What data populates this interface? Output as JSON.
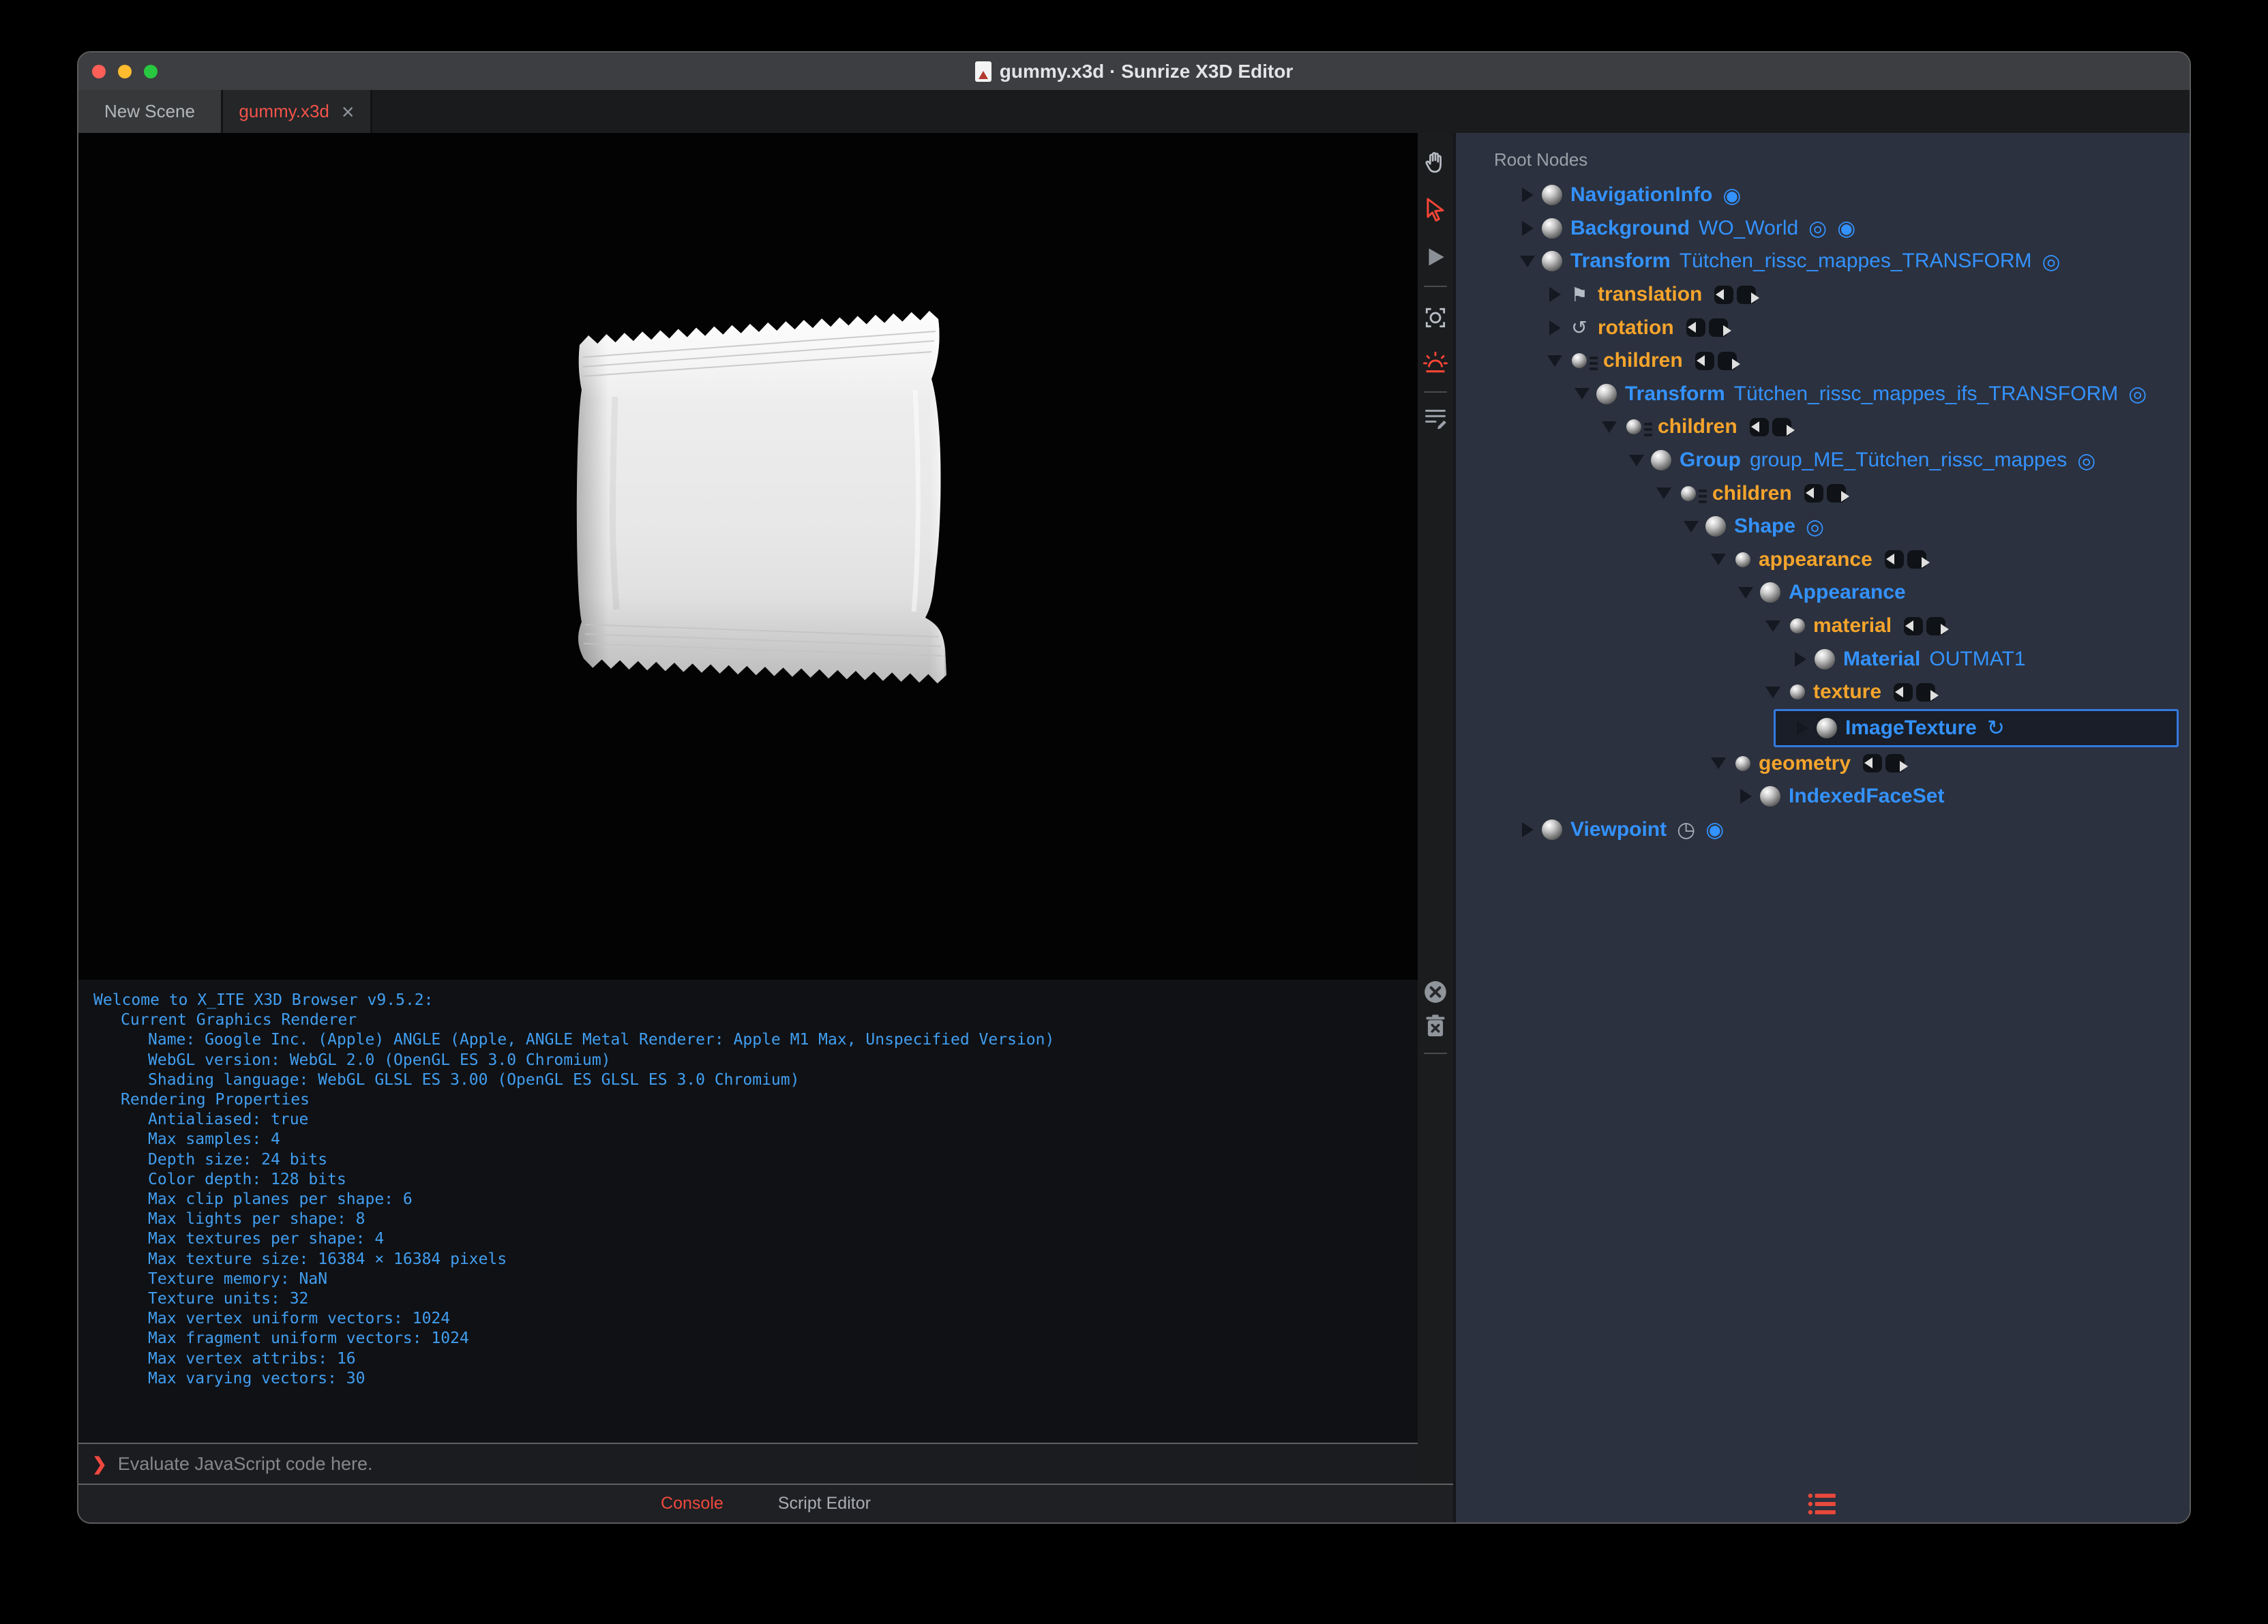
{
  "window": {
    "title": "gummy.x3d · Sunrize X3D Editor"
  },
  "tabs": [
    {
      "label": "New Scene",
      "active": false
    },
    {
      "label": "gummy.x3d",
      "active": true,
      "close": "×"
    }
  ],
  "toolbar": {
    "top_icons": [
      "pan-hand",
      "select-arrow",
      "play",
      "snapshot",
      "headlight",
      "script-editor"
    ],
    "console_icons": [
      "clear-console",
      "clear-console-on-reload"
    ],
    "active_icon_color": "#ff4636"
  },
  "console": {
    "lines": [
      {
        "indent": 0,
        "text": "Welcome to X_ITE X3D Browser v9.5.2:"
      },
      {
        "indent": 1,
        "text": "Current Graphics Renderer"
      },
      {
        "indent": 2,
        "text": "Name: Google Inc. (Apple) ANGLE (Apple, ANGLE Metal Renderer: Apple M1 Max, Unspecified Version)"
      },
      {
        "indent": 2,
        "text": "WebGL version: WebGL 2.0 (OpenGL ES 3.0 Chromium)"
      },
      {
        "indent": 2,
        "text": "Shading language: WebGL GLSL ES 3.00 (OpenGL ES GLSL ES 3.0 Chromium)"
      },
      {
        "indent": 1,
        "text": "Rendering Properties"
      },
      {
        "indent": 2,
        "text": "Antialiased: true"
      },
      {
        "indent": 2,
        "text": "Max samples: 4"
      },
      {
        "indent": 2,
        "text": "Depth size: 24 bits"
      },
      {
        "indent": 2,
        "text": "Color depth: 128 bits"
      },
      {
        "indent": 2,
        "text": "Max clip planes per shape: 6"
      },
      {
        "indent": 2,
        "text": "Max lights per shape: 8"
      },
      {
        "indent": 2,
        "text": "Max textures per shape: 4"
      },
      {
        "indent": 2,
        "text": "Max texture size: 16384 × 16384 pixels"
      },
      {
        "indent": 2,
        "text": "Texture memory: NaN"
      },
      {
        "indent": 2,
        "text": "Texture units: 32"
      },
      {
        "indent": 2,
        "text": "Max vertex uniform vectors: 1024"
      },
      {
        "indent": 2,
        "text": "Max fragment uniform vectors: 1024"
      },
      {
        "indent": 2,
        "text": "Max vertex attribs: 16"
      },
      {
        "indent": 2,
        "text": "Max varying vectors: 30"
      }
    ],
    "prompt_symbol": "❯",
    "prompt_placeholder": "Evaluate JavaScript code here.",
    "tabs": [
      {
        "label": "Console",
        "active": true
      },
      {
        "label": "Script Editor",
        "active": false
      }
    ]
  },
  "outline": {
    "header": "Root Nodes",
    "rows": [
      {
        "level": 0,
        "arrow": "collapsed",
        "icon": "node-sphere",
        "name": "NavigationInfo",
        "name_style": "node",
        "extras": [
          "bind"
        ]
      },
      {
        "level": 0,
        "arrow": "collapsed",
        "icon": "node-sphere",
        "name": "Background",
        "def": "WO_World",
        "name_style": "node",
        "extras": [
          "eye",
          "bind"
        ]
      },
      {
        "level": 0,
        "arrow": "expanded",
        "icon": "node-sphere",
        "name": "Transform",
        "def": "Tütchen_rissc_mappes_TRANSFORM",
        "name_style": "node",
        "extras": [
          "eye"
        ]
      },
      {
        "level": 1,
        "arrow": "collapsed",
        "icon": "field-translation",
        "name": "translation",
        "name_style": "field",
        "extras": [
          "routes"
        ]
      },
      {
        "level": 1,
        "arrow": "collapsed",
        "icon": "field-rotation",
        "name": "rotation",
        "name_style": "field",
        "extras": [
          "routes"
        ]
      },
      {
        "level": 1,
        "arrow": "expanded",
        "icon": "field-children",
        "name": "children",
        "name_style": "field",
        "extras": [
          "routes"
        ]
      },
      {
        "level": 2,
        "arrow": "expanded",
        "icon": "node-sphere",
        "name": "Transform",
        "def": "Tütchen_rissc_mappes_ifs_TRANSFORM",
        "name_style": "node",
        "extras": [
          "eye"
        ]
      },
      {
        "level": 3,
        "arrow": "expanded",
        "icon": "field-children",
        "name": "children",
        "name_style": "field",
        "extras": [
          "routes"
        ]
      },
      {
        "level": 4,
        "arrow": "expanded",
        "icon": "node-sphere",
        "name": "Group",
        "def": "group_ME_Tütchen_rissc_mappes",
        "name_style": "node",
        "extras": [
          "eye"
        ]
      },
      {
        "level": 5,
        "arrow": "expanded",
        "icon": "field-children",
        "name": "children",
        "name_style": "field",
        "extras": [
          "routes"
        ]
      },
      {
        "level": 6,
        "arrow": "expanded",
        "icon": "node-sphere",
        "name": "Shape",
        "name_style": "node",
        "extras": [
          "eye"
        ]
      },
      {
        "level": 7,
        "arrow": "expanded",
        "icon": "field-generic",
        "name": "appearance",
        "name_style": "field",
        "extras": [
          "routes"
        ]
      },
      {
        "level": 8,
        "arrow": "expanded",
        "icon": "node-sphere",
        "name": "Appearance",
        "name_style": "node",
        "extras": []
      },
      {
        "level": 9,
        "arrow": "expanded",
        "icon": "field-generic",
        "name": "material",
        "name_style": "field",
        "extras": [
          "routes"
        ]
      },
      {
        "level": 10,
        "arrow": "collapsed",
        "icon": "node-sphere",
        "name": "Material",
        "def": "OUTMAT1",
        "name_style": "node",
        "extras": []
      },
      {
        "level": 9,
        "arrow": "expanded",
        "icon": "field-generic",
        "name": "texture",
        "name_style": "field",
        "extras": [
          "routes"
        ]
      },
      {
        "level": 10,
        "arrow": "collapsed",
        "icon": "node-sphere",
        "name": "ImageTexture",
        "name_style": "node",
        "extras": [
          "refresh"
        ],
        "selected": true
      },
      {
        "level": 7,
        "arrow": "expanded",
        "icon": "field-generic",
        "name": "geometry",
        "name_style": "field",
        "extras": [
          "routes"
        ]
      },
      {
        "level": 8,
        "arrow": "collapsed",
        "icon": "node-sphere",
        "name": "IndexedFaceSet",
        "name_style": "node",
        "extras": []
      },
      {
        "level": 0,
        "arrow": "collapsed",
        "icon": "node-sphere",
        "name": "Viewpoint",
        "name_style": "node",
        "extras": [
          "clock",
          "bind"
        ]
      }
    ]
  },
  "colors": {
    "accent_red": "#f0483e",
    "node_blue": "#3492ff",
    "field_orange": "#f5a42c",
    "console_blue": "#419ef0",
    "selection_border": "#3579e0",
    "panel_bg": "#2b313e",
    "traffic_red": "#ff5f57",
    "traffic_yellow": "#febc2e",
    "traffic_green": "#28c840"
  }
}
